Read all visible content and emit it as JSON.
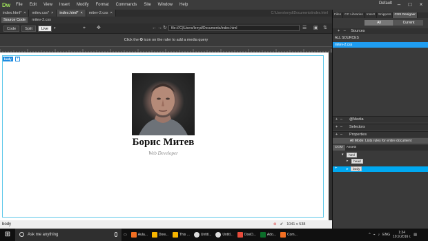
{
  "menu": {
    "logo": "Dw",
    "items": [
      "File",
      "Edit",
      "View",
      "Insert",
      "Modify",
      "Format",
      "Commands",
      "Site",
      "Window",
      "Help"
    ],
    "workspace": "Default"
  },
  "tabs": [
    {
      "label": "index.html*",
      "close": "×"
    },
    {
      "label": "mitev.css*",
      "close": "×"
    },
    {
      "label": "index.html*",
      "close": "×"
    },
    {
      "label": "mitev-2.css",
      "close": "×"
    }
  ],
  "file_path": "C:\\Users\\enyd\\Documents\\index.html",
  "related": {
    "source": "Source Code",
    "css": "mitev-2.css"
  },
  "view": {
    "code": "Code",
    "split": "Split",
    "live": "Live",
    "url": "file:///C|/Users/lenyd/Documents/index.html"
  },
  "media_query_hint": "Click the ✪ icon on the ruler to add a media query",
  "page": {
    "body_tag": "body",
    "name": "Борис Митев",
    "role": "Web Developer"
  },
  "status": {
    "left": "body",
    "size": "1041 x 538"
  },
  "panel": {
    "tabs": [
      "Files",
      "CC Libraries",
      "Insert",
      "Snippets",
      "CSS Designer"
    ],
    "all_label": "All",
    "current_label": "Current",
    "sources_label": "Sources",
    "all_sources": "ALL SOURCES",
    "selected_source": "mitev-2.css",
    "media_label": "@Media",
    "selectors_label": "Selectors",
    "properties_label": "Properties",
    "mode_text": "All Mode: Lists rules for entire document",
    "dom_tabs": [
      "DOM",
      "Assets"
    ],
    "dom_nodes": [
      "html",
      "head",
      "body"
    ]
  },
  "taskbar": {
    "search_placeholder": "Ask me anything",
    "apps": [
      {
        "label": "Aula...",
        "color": "#f36f22"
      },
      {
        "label": "Dow...",
        "color": "#f7b500"
      },
      {
        "label": "This ...",
        "color": "#f7b500"
      },
      {
        "label": "Untitl...",
        "color": "#dddddd"
      },
      {
        "label": "Untitl...",
        "color": "#dddddd"
      },
      {
        "label": "DoeD...",
        "color": "#e74c3c"
      },
      {
        "label": "Ado...",
        "color": "#0b6e2a"
      },
      {
        "label": "Com...",
        "color": "#f36f22"
      }
    ],
    "language": "ENG",
    "time": "1:34",
    "date": "10.9.2016 г."
  },
  "colors": {
    "accent": "#1f9df1",
    "dw_green": "#9fe25a",
    "frame": "#5bc7e9"
  }
}
